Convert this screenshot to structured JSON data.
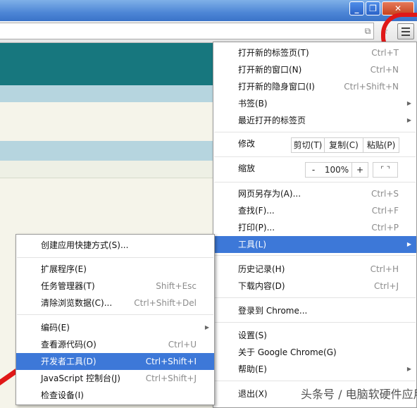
{
  "window": {
    "minimize": "_",
    "restore": "❐",
    "close": "✕"
  },
  "toolbar": {
    "menu_icon": "hamburger-icon"
  },
  "main_menu": {
    "items": [
      {
        "label": "打开新的标签页(T)",
        "shortcut": "Ctrl+T"
      },
      {
        "label": "打开新的窗口(N)",
        "shortcut": "Ctrl+N"
      },
      {
        "label": "打开新的隐身窗口(I)",
        "shortcut": "Ctrl+Shift+N"
      },
      {
        "label": "书签(B)",
        "submenu": true
      },
      {
        "label": "最近打开的标签页",
        "submenu": true
      },
      {
        "label": "网页另存为(A)...",
        "shortcut": "Ctrl+S"
      },
      {
        "label": "查找(F)...",
        "shortcut": "Ctrl+F"
      },
      {
        "label": "打印(P)...",
        "shortcut": "Ctrl+P"
      },
      {
        "label": "工具(L)",
        "submenu": true,
        "highlighted": true
      },
      {
        "label": "历史记录(H)",
        "shortcut": "Ctrl+H"
      },
      {
        "label": "下载内容(D)",
        "shortcut": "Ctrl+J"
      },
      {
        "label": "登录到 Chrome..."
      },
      {
        "label": "设置(S)"
      },
      {
        "label": "关于 Google Chrome(G)"
      },
      {
        "label": "帮助(E)",
        "submenu": true
      },
      {
        "label": "退出(X)"
      }
    ],
    "edit": {
      "label": "修改",
      "cut": "剪切(T)",
      "copy": "复制(C)",
      "paste": "粘贴(P)"
    },
    "zoom": {
      "label": "缩放",
      "minus": "-",
      "value": "100%",
      "plus": "+",
      "fullscreen_icon": "fullscreen-icon"
    }
  },
  "tools_menu": {
    "items": [
      {
        "label": "创建应用快捷方式(S)..."
      },
      {
        "label": "扩展程序(E)"
      },
      {
        "label": "任务管理器(T)",
        "shortcut": "Shift+Esc"
      },
      {
        "label": "清除浏览数据(C)...",
        "shortcut": "Ctrl+Shift+Del"
      },
      {
        "label": "编码(E)",
        "submenu": true
      },
      {
        "label": "查看源代码(O)",
        "shortcut": "Ctrl+U"
      },
      {
        "label": "开发者工具(D)",
        "shortcut": "Ctrl+Shift+I",
        "highlighted": true
      },
      {
        "label": "JavaScript 控制台(J)",
        "shortcut": "Ctrl+Shift+J"
      },
      {
        "label": "检查设备(I)"
      }
    ]
  },
  "watermark": {
    "text": "头条号 / 电脑软硬件应用网"
  },
  "colors": {
    "highlight": "#3d78d8",
    "teal": "#17777e",
    "annotation": "#e01818"
  }
}
